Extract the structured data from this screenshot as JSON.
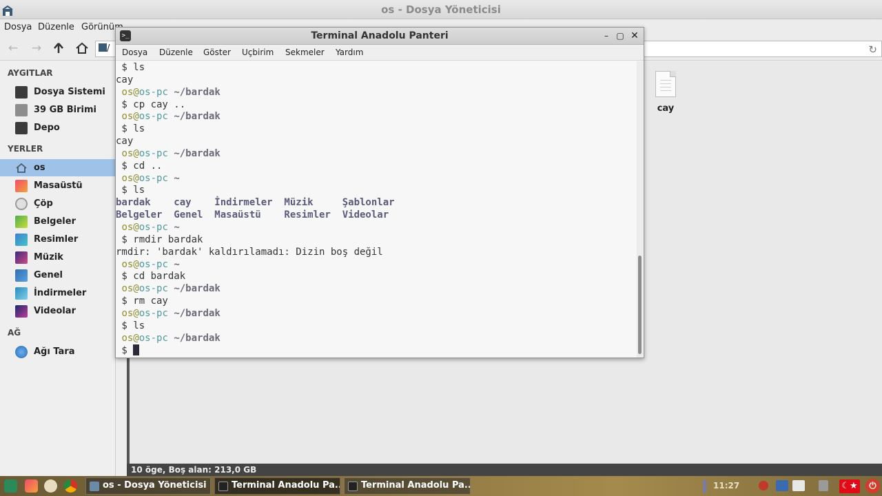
{
  "file_manager": {
    "title": "os - Dosya Yöneticisi",
    "menu": {
      "file": "Dosya",
      "edit": "Düzenle",
      "view": "Görünüm"
    },
    "path_fragment": "/",
    "sidebar": {
      "devices_heading": "AYGITLAR",
      "devices": [
        "Dosya Sistemi",
        "39 GB Birimi",
        "Depo"
      ],
      "places_heading": "YERLER",
      "places": [
        "os",
        "Masaüstü",
        "Çöp",
        "Belgeler",
        "Resimler",
        "Müzik",
        "Genel",
        "İndirmeler",
        "Videolar"
      ],
      "network_heading": "AĞ",
      "network": [
        "Ağı Tara"
      ]
    },
    "files": [
      "cay"
    ],
    "status": "10 öge, Boş alan: 213,0 GB"
  },
  "terminal": {
    "title": "Terminal Anadolu Panteri",
    "menu": [
      "Dosya",
      "Düzenle",
      "Göster",
      "Uçbirim",
      "Sekmeler",
      "Yardım"
    ],
    "user": "os",
    "at": "@",
    "host": "os-pc",
    "prompt": "$",
    "lines": [
      {
        "t": "cmd",
        "text": " ls"
      },
      {
        "t": "out",
        "text": "cay"
      },
      {
        "t": "ps",
        "path": " ~/bardak"
      },
      {
        "t": "cmd",
        "text": " cp cay .."
      },
      {
        "t": "ps",
        "path": " ~/bardak"
      },
      {
        "t": "cmd",
        "text": " ls"
      },
      {
        "t": "out",
        "text": "cay"
      },
      {
        "t": "ps",
        "path": " ~/bardak"
      },
      {
        "t": "cmd",
        "text": " cd .."
      },
      {
        "t": "ps",
        "path": " ~"
      },
      {
        "t": "cmd",
        "text": " ls"
      },
      {
        "t": "dirs",
        "text": "bardak    cay    İndirmeler  Müzik     Şablonlar"
      },
      {
        "t": "dirs",
        "text": "Belgeler  Genel  Masaüstü    Resimler  Videolar"
      },
      {
        "t": "ps",
        "path": " ~"
      },
      {
        "t": "cmd",
        "text": " rmdir bardak"
      },
      {
        "t": "out",
        "text": "rmdir: 'bardak' kaldırılamadı: Dizin boş değil"
      },
      {
        "t": "ps",
        "path": " ~"
      },
      {
        "t": "cmd",
        "text": " cd bardak"
      },
      {
        "t": "ps",
        "path": " ~/bardak"
      },
      {
        "t": "cmd",
        "text": " rm cay"
      },
      {
        "t": "ps",
        "path": " ~/bardak"
      },
      {
        "t": "cmd",
        "text": " ls"
      },
      {
        "t": "ps",
        "path": " ~/bardak"
      },
      {
        "t": "cursor",
        "text": " "
      }
    ]
  },
  "taskbar": {
    "tasks": [
      "os - Dosya Yöneticisi",
      "Terminal Anadolu Pa...",
      "Terminal Anadolu Pa..."
    ],
    "clock": "11:27"
  },
  "colors": {
    "sidebar_selection": "#9ec2e8",
    "prompt_user": "#8e8e2e",
    "prompt_host": "#4f9aa0",
    "flag_red": "#e30a17"
  }
}
